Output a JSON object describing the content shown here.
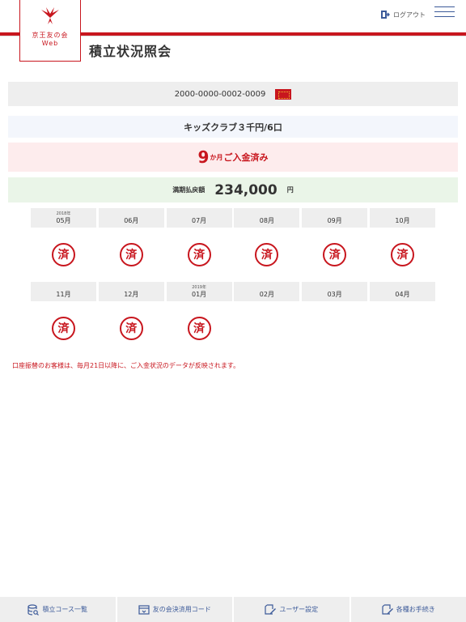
{
  "logo": {
    "line1": "京王友の会",
    "line2": "Web"
  },
  "header": {
    "logout_label": "ログアウト",
    "page_title": "積立状況照会"
  },
  "account": {
    "number": "2000-0000-0002-0009"
  },
  "course": {
    "name": "キッズクラブ３千円/6口"
  },
  "paid": {
    "count": "9",
    "unit": "か月",
    "text": "ご入金済み"
  },
  "maturity": {
    "label": "満期払戻額",
    "amount": "234,000",
    "unit": "円"
  },
  "months_row1": [
    {
      "year": "2018年",
      "month": "05月",
      "stamp": "済"
    },
    {
      "year": "",
      "month": "06月",
      "stamp": "済"
    },
    {
      "year": "",
      "month": "07月",
      "stamp": "済"
    },
    {
      "year": "",
      "month": "08月",
      "stamp": "済"
    },
    {
      "year": "",
      "month": "09月",
      "stamp": "済"
    },
    {
      "year": "",
      "month": "10月",
      "stamp": "済"
    }
  ],
  "months_row2": [
    {
      "year": "",
      "month": "11月",
      "stamp": "済"
    },
    {
      "year": "",
      "month": "12月",
      "stamp": "済"
    },
    {
      "year": "2019年",
      "month": "01月",
      "stamp": "済"
    },
    {
      "year": "",
      "month": "02月",
      "stamp": ""
    },
    {
      "year": "",
      "month": "03月",
      "stamp": ""
    },
    {
      "year": "",
      "month": "04月",
      "stamp": ""
    }
  ],
  "note": "口座振替のお客様は、毎月21日以降に、ご入金状況のデータが反映されます。",
  "bottom_nav": [
    {
      "label": "積立コース一覧",
      "icon": "database-search-icon"
    },
    {
      "label": "友の会決済用コード",
      "icon": "wallet-card-icon"
    },
    {
      "label": "ユーザー設定",
      "icon": "edit-document-icon"
    },
    {
      "label": "各種お手続き",
      "icon": "edit-document-icon"
    }
  ],
  "colors": {
    "accent": "#c8161e",
    "nav": "#3c5a99"
  }
}
